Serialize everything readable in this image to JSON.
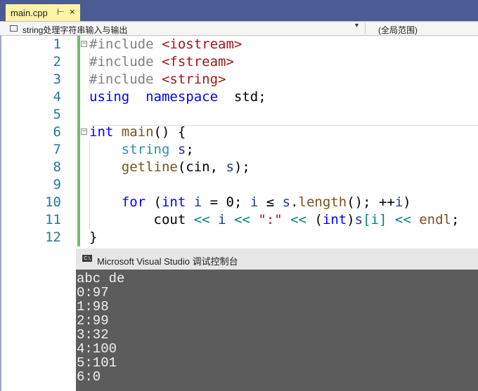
{
  "tab": {
    "filename": "main.cpp",
    "pin_glyph": "⊢",
    "close_glyph": "×"
  },
  "navbar": {
    "scope": "string处理字符串输入与输出",
    "arrow": "▾",
    "global_scope": "(全局范围)"
  },
  "editor": {
    "lines": [
      {
        "no": "1",
        "tokens": [
          [
            "pp",
            "#include "
          ],
          [
            "str",
            "<iostream>"
          ]
        ]
      },
      {
        "no": "2",
        "tokens": [
          [
            "pp",
            "#include "
          ],
          [
            "str",
            "<fstream>"
          ]
        ]
      },
      {
        "no": "3",
        "tokens": [
          [
            "pp",
            "#include "
          ],
          [
            "str",
            "<string>"
          ]
        ]
      },
      {
        "no": "4",
        "tokens": [
          [
            "kw",
            "using"
          ],
          [
            "",
            "  "
          ],
          [
            "kw",
            "namespace"
          ],
          [
            "",
            "  std;"
          ]
        ]
      },
      {
        "no": "5",
        "tokens": []
      },
      {
        "no": "6",
        "tokens": [
          [
            "kw",
            "int"
          ],
          [
            "",
            " "
          ],
          [
            "fn",
            "main"
          ],
          [
            "",
            "() {"
          ]
        ]
      },
      {
        "no": "7",
        "tokens": [
          [
            "",
            "    "
          ],
          [
            "ty",
            "string"
          ],
          [
            "",
            " "
          ],
          [
            "va",
            "s"
          ],
          [
            "",
            ";"
          ]
        ]
      },
      {
        "no": "8",
        "tokens": [
          [
            "",
            "    "
          ],
          [
            "fn",
            "getline"
          ],
          [
            "",
            "(cin, "
          ],
          [
            "va",
            "s"
          ],
          [
            "",
            ");"
          ]
        ]
      },
      {
        "no": "9",
        "tokens": []
      },
      {
        "no": "10",
        "tokens": [
          [
            "",
            "    "
          ],
          [
            "kw",
            "for"
          ],
          [
            "",
            " ("
          ],
          [
            "kw",
            "int"
          ],
          [
            "",
            " "
          ],
          [
            "va",
            "i"
          ],
          [
            "",
            " = 0; "
          ],
          [
            "va",
            "i"
          ],
          [
            "",
            " ≤ "
          ],
          [
            "va",
            "s"
          ],
          [
            "",
            "."
          ],
          [
            "fn",
            "length"
          ],
          [
            "",
            "(); ++"
          ],
          [
            "va",
            "i"
          ],
          [
            "",
            ")"
          ]
        ]
      },
      {
        "no": "11",
        "tokens": [
          [
            "",
            "        cout "
          ],
          [
            "op",
            "<<"
          ],
          [
            "",
            " "
          ],
          [
            "va",
            "i"
          ],
          [
            "",
            " "
          ],
          [
            "op",
            "<<"
          ],
          [
            "",
            " "
          ],
          [
            "str",
            "\":\""
          ],
          [
            "",
            " "
          ],
          [
            "op",
            "<<"
          ],
          [
            "",
            " ("
          ],
          [
            "kw",
            "int"
          ],
          [
            "",
            ")"
          ],
          [
            "va",
            "s"
          ],
          [
            "op",
            "[i]"
          ],
          [
            "",
            " "
          ],
          [
            "op",
            "<<"
          ],
          [
            "",
            " "
          ],
          [
            "fn",
            "endl"
          ],
          [
            "",
            ";"
          ]
        ]
      },
      {
        "no": "12",
        "tokens": [
          [
            "",
            "}"
          ]
        ]
      }
    ]
  },
  "console": {
    "icon_text": "C:\\",
    "title": "Microsoft Visual Studio 调试控制台",
    "output": [
      "abc de",
      "0:97",
      "1:98",
      "2:99",
      "3:32",
      "4:100",
      "5:101",
      "6:0"
    ]
  }
}
